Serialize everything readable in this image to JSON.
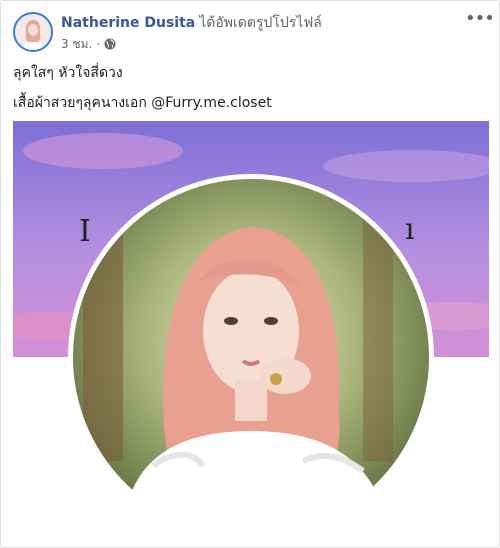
{
  "post": {
    "author": "Natherine Dusita",
    "action": "ได้อัพเดตรูปโปรไฟล์",
    "time": "3 ชม.",
    "separator": "·",
    "privacy_icon": "globe-icon",
    "menu_icon": "more-horizontal-icon",
    "text_line1": "ลุคใสๆ หัวใจสี่ดวง",
    "text_line2": "เสื้อผ้าสวยๆลุคนางเอก @Furry.me.closet"
  },
  "colors": {
    "author_link": "#385898",
    "meta_text": "#606770",
    "avatar_ring": "#3578e5",
    "cover_sky_top": "#7c6fd6",
    "cover_sky_bottom": "#d38fd6",
    "profile_ring": "#ffffff"
  },
  "media": {
    "cover_photo": "purple-sky-cover-photo",
    "profile_photo": "woman-pink-hair-white-dress-profile-photo"
  }
}
